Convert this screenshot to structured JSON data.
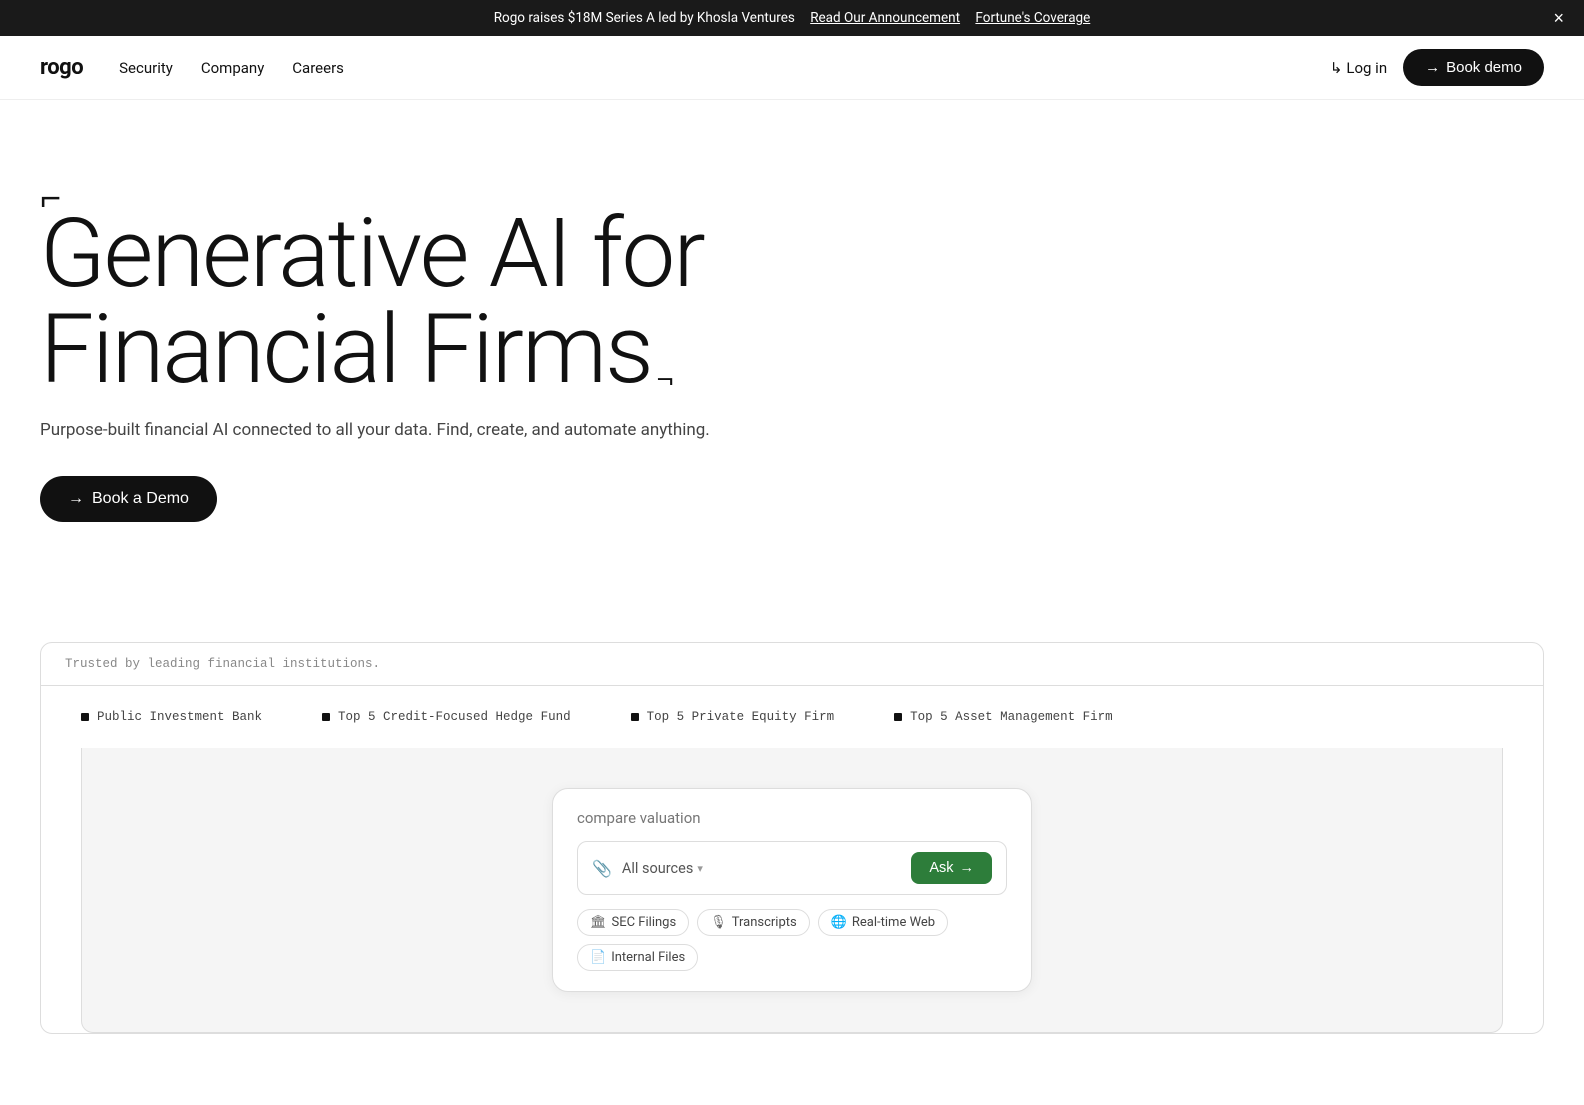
{
  "announcement": {
    "text": "Rogo raises $18M Series A led by Khosla Ventures",
    "link1_label": "Read Our Announcement",
    "link2_label": "Fortune's Coverage",
    "close_label": "×"
  },
  "nav": {
    "logo": "rogo",
    "links": [
      {
        "label": "Security",
        "href": "#"
      },
      {
        "label": "Company",
        "href": "#"
      },
      {
        "label": "Careers",
        "href": "#"
      }
    ],
    "login_label": "Log in",
    "login_arrow": "↳",
    "book_demo_label": "Book demo",
    "book_demo_arrow": "→"
  },
  "hero": {
    "bracket_top": "⌐",
    "title_line1": "Generative AI for",
    "title_line2": "Financial Firms",
    "bracket_bottom": "¬",
    "subtitle": "Purpose-built financial AI connected to all your data. Find, create, and automate anything.",
    "cta_arrow": "→",
    "cta_label": "Book a Demo"
  },
  "trusted": {
    "label": "Trusted by leading financial institutions.",
    "items": [
      "Public Investment Bank",
      "Top 5 Credit-Focused Hedge Fund",
      "Top 5 Private Equity Firm",
      "Top 5 Asset Management Firm"
    ]
  },
  "search_demo": {
    "query_placeholder": "compare valuation",
    "sources_label": "All sources",
    "ask_label": "Ask",
    "ask_arrow": "→",
    "tags": [
      {
        "label": "SEC Filings",
        "icon": "🏛"
      },
      {
        "label": "Transcripts",
        "icon": "🎙"
      },
      {
        "label": "Real-time Web",
        "icon": "🌐"
      },
      {
        "label": "Internal Files",
        "icon": "📄"
      }
    ]
  }
}
